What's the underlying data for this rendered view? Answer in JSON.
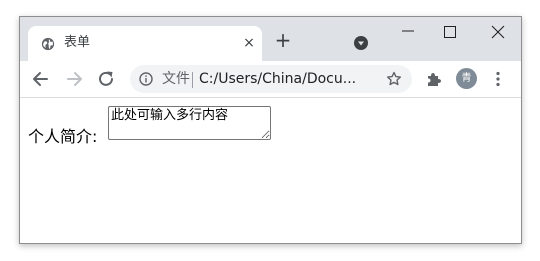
{
  "browser": {
    "tab": {
      "title": "表单",
      "favicon": "globe-icon",
      "close": "×"
    },
    "new_tab_icon": "+",
    "window_controls": [
      "minimize-icon",
      "maximize-icon",
      "close-icon"
    ],
    "toolbar": {
      "back_icon": "arrow-left-icon",
      "forward_icon": "arrow-right-icon",
      "reload_icon": "reload-icon",
      "security_chip": "文件",
      "url": "C:/Users/China/Docu...",
      "bookmark_icon": "star-icon",
      "extensions_icon": "puzzle-icon",
      "profile_initial": "青",
      "menu_icon": "kebab-menu-icon"
    }
  },
  "page": {
    "label": "个人简介:",
    "textarea": {
      "value": "此处可输入多行内容"
    }
  },
  "colors": {
    "tabstrip": "#dee1e6",
    "omnibox": "#f1f3f4",
    "avatar": "#7f8b96",
    "icon": "#5f6368"
  }
}
